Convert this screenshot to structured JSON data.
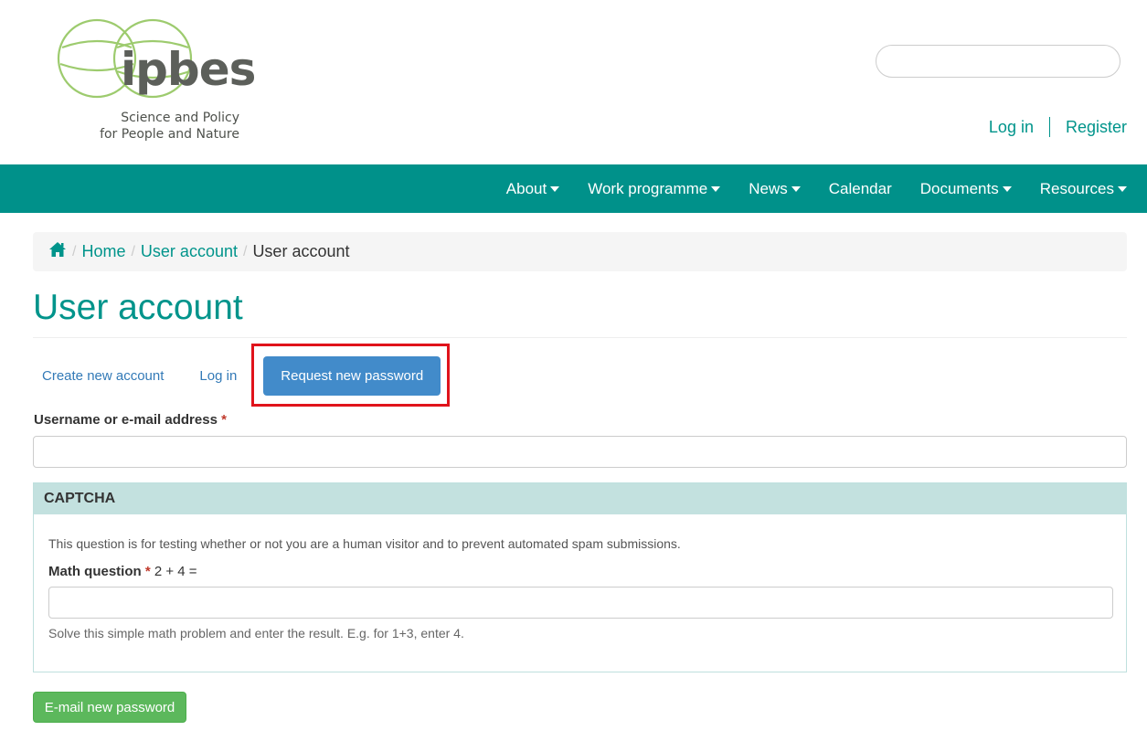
{
  "logo": {
    "word": "ipbes",
    "tagline_line1": "Science and Policy",
    "tagline_line2": "for People and Nature"
  },
  "search": {
    "placeholder": "",
    "value": ""
  },
  "user_links": {
    "login": "Log in",
    "register": "Register"
  },
  "nav": {
    "items": [
      {
        "label": "About",
        "has_dropdown": true
      },
      {
        "label": "Work programme",
        "has_dropdown": true
      },
      {
        "label": "News",
        "has_dropdown": true
      },
      {
        "label": "Calendar",
        "has_dropdown": false
      },
      {
        "label": "Documents",
        "has_dropdown": true
      },
      {
        "label": "Resources",
        "has_dropdown": true
      }
    ]
  },
  "breadcrumb": {
    "home_icon": "home-icon",
    "items": [
      "Home",
      "User account"
    ],
    "current": "User account"
  },
  "page": {
    "title": "User account"
  },
  "tabs": [
    {
      "label": "Create new account",
      "active": false
    },
    {
      "label": "Log in",
      "active": false
    },
    {
      "label": "Request new password",
      "active": true
    }
  ],
  "form": {
    "username_label": "Username or e-mail address",
    "required_marker": "*",
    "username_value": ""
  },
  "captcha": {
    "heading": "CAPTCHA",
    "description": "This question is for testing whether or not you are a human visitor and to prevent automated spam submissions.",
    "math_label": "Math question",
    "math_problem": "2 + 4 =",
    "math_value": "",
    "help": "Solve this simple math problem and enter the result. E.g. for 1+3, enter 4."
  },
  "submit": {
    "label": "E-mail new password"
  },
  "colors": {
    "brand": "#00918a",
    "link": "#00948b",
    "tab_active": "#428bca",
    "submit": "#5cb85c",
    "highlight": "#e0131b"
  }
}
